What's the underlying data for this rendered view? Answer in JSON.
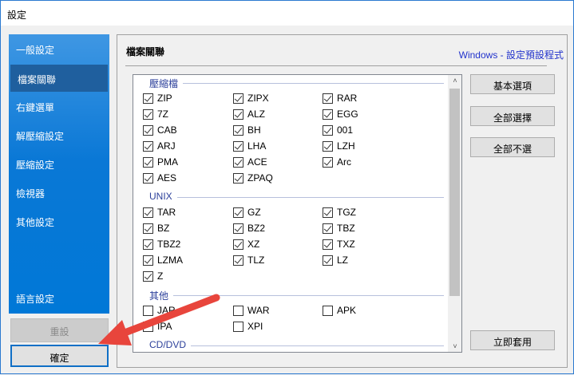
{
  "window": {
    "title": "設定"
  },
  "sidebar": {
    "items": [
      {
        "label": "一般設定"
      },
      {
        "label": "檔案關聯"
      },
      {
        "label": "右鍵選單"
      },
      {
        "label": "解壓縮設定"
      },
      {
        "label": "壓縮設定"
      },
      {
        "label": "檢視器"
      },
      {
        "label": "其他設定"
      },
      {
        "label": "語言設定"
      }
    ],
    "selected": "檔案關聯"
  },
  "buttons": {
    "reset": "重設",
    "ok": "確定",
    "basic": "基本選項",
    "select_all": "全部選擇",
    "deselect_all": "全部不選",
    "apply": "立即套用"
  },
  "panel": {
    "title": "檔案關聯",
    "link": "Windows - 設定預設程式"
  },
  "groups": [
    {
      "name": "壓縮檔",
      "items": [
        {
          "label": "ZIP",
          "checked": true
        },
        {
          "label": "ZIPX",
          "checked": true
        },
        {
          "label": "RAR",
          "checked": true
        },
        {
          "label": "7Z",
          "checked": true
        },
        {
          "label": "ALZ",
          "checked": true
        },
        {
          "label": "EGG",
          "checked": true
        },
        {
          "label": "CAB",
          "checked": true
        },
        {
          "label": "BH",
          "checked": true
        },
        {
          "label": "001",
          "checked": true
        },
        {
          "label": "ARJ",
          "checked": true
        },
        {
          "label": "LHA",
          "checked": true
        },
        {
          "label": "LZH",
          "checked": true
        },
        {
          "label": "PMA",
          "checked": true
        },
        {
          "label": "ACE",
          "checked": true
        },
        {
          "label": "Arc",
          "checked": true
        },
        {
          "label": "AES",
          "checked": true
        },
        {
          "label": "ZPAQ",
          "checked": true
        }
      ]
    },
    {
      "name": "UNIX",
      "items": [
        {
          "label": "TAR",
          "checked": true
        },
        {
          "label": "GZ",
          "checked": true
        },
        {
          "label": "TGZ",
          "checked": true
        },
        {
          "label": "BZ",
          "checked": true
        },
        {
          "label": "BZ2",
          "checked": true
        },
        {
          "label": "TBZ",
          "checked": true
        },
        {
          "label": "TBZ2",
          "checked": true
        },
        {
          "label": "XZ",
          "checked": true
        },
        {
          "label": "TXZ",
          "checked": true
        },
        {
          "label": "LZMA",
          "checked": true
        },
        {
          "label": "TLZ",
          "checked": true
        },
        {
          "label": "LZ",
          "checked": true
        },
        {
          "label": "Z",
          "checked": true
        }
      ]
    },
    {
      "name": "其他",
      "items": [
        {
          "label": "JAR",
          "checked": false
        },
        {
          "label": "WAR",
          "checked": false
        },
        {
          "label": "APK",
          "checked": false
        },
        {
          "label": "IPA",
          "checked": false
        },
        {
          "label": "XPI",
          "checked": false
        }
      ]
    },
    {
      "name": "CD/DVD",
      "items": []
    }
  ],
  "annotation": {
    "color": "#e8453c"
  }
}
